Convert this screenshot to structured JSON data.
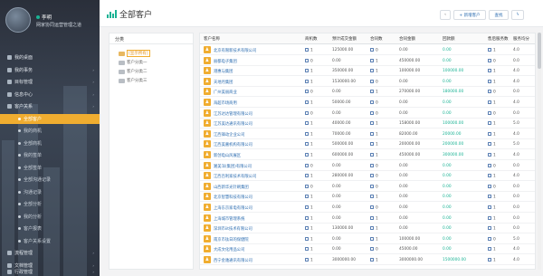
{
  "sidebar": {
    "user": {
      "name": "李明",
      "role": "网家协同运营管理之道"
    },
    "items": [
      {
        "label": "我的桌面",
        "icon": "monitor-icon"
      },
      {
        "label": "我的事务",
        "icon": "inbox-icon",
        "caret": true
      },
      {
        "label": "目标管理",
        "icon": "target-icon",
        "caret": true
      },
      {
        "label": "信息中心",
        "icon": "info-icon",
        "caret": true
      },
      {
        "label": "客户关系",
        "icon": "customer-icon",
        "caret": true
      },
      {
        "label": "全部客户",
        "sub": true,
        "active": true
      },
      {
        "label": "我的商机",
        "sub": true
      },
      {
        "label": "全部商机",
        "sub": true
      },
      {
        "label": "我的签单",
        "sub": true
      },
      {
        "label": "全部签单",
        "sub": true
      },
      {
        "label": "全部沟通记录",
        "sub": true
      },
      {
        "label": "沟通记录",
        "sub": true
      },
      {
        "label": "全部分析",
        "sub": true
      },
      {
        "label": "我的分析",
        "sub": true
      },
      {
        "label": "客户报表",
        "sub": true
      },
      {
        "label": "客户关系设置",
        "sub": true
      },
      {
        "label": "流程管理",
        "icon": "flow-icon",
        "caret": true
      },
      {
        "label": "文档管理",
        "icon": "doc-icon",
        "caret": true
      },
      {
        "label": "行政管理",
        "icon": "admin-icon",
        "caret": true
      }
    ]
  },
  "header": {
    "title": "全部客户",
    "buttons": {
      "back": "‹",
      "new": "+ 新增客户",
      "search": "查找",
      "help": "ϟ"
    }
  },
  "categories": {
    "title": "分类",
    "items": [
      {
        "label": "[显示所有]",
        "selected": true
      },
      {
        "label": "客户分类一"
      },
      {
        "label": "客户分类二"
      },
      {
        "label": "客户分类三"
      }
    ]
  },
  "table": {
    "columns": [
      "客户名称",
      "商机数",
      "预计成交金额",
      "合同数",
      "合同金额",
      "回款额",
      "售后服务数",
      "服务均分"
    ],
    "rows": [
      [
        "北京有限新技术有限公司",
        "1",
        "125000.00",
        "0",
        "0.00",
        "0.00",
        "1",
        "4.0"
      ],
      [
        "丽都电子集团",
        "0",
        "0.00",
        "1",
        "450000.00",
        "0.00",
        "0",
        "0.0"
      ],
      [
        "港惠与集团",
        "1",
        "350000.00",
        "1",
        "100000.00",
        "100000.00",
        "1",
        "4.0"
      ],
      [
        "天地月集团",
        "1",
        "1530000.00",
        "0",
        "0.00",
        "0.00",
        "1",
        "4.0"
      ],
      [
        "广州美丽商业",
        "0",
        "0.00",
        "1",
        "270000.00",
        "180000.00",
        "0",
        "0.0"
      ],
      [
        "海超市场商用",
        "1",
        "50000.00",
        "0",
        "0.00",
        "0.00",
        "1",
        "4.0"
      ],
      [
        "江苏达达管理有限公司",
        "0",
        "0.00",
        "0",
        "0.00",
        "0.00",
        "0",
        "0.0"
      ],
      [
        "江苏美达通讯有限公司",
        "1",
        "40000.00",
        "1",
        "158000.00",
        "100000.00",
        "1",
        "5.0"
      ],
      [
        "江西锋动企业公司",
        "1",
        "70000.00",
        "1",
        "82000.00",
        "20000.00",
        "1",
        "4.0"
      ],
      [
        "江西美嘉机构有限公司",
        "1",
        "500000.00",
        "1",
        "200000.00",
        "200000.00",
        "1",
        "5.0"
      ],
      [
        "新创电山风展区",
        "1",
        "600000.00",
        "1",
        "450000.00",
        "300000.00",
        "1",
        "4.0"
      ],
      [
        "湘美洋(集团)有限公司",
        "0",
        "0.00",
        "0",
        "0.00",
        "0.00",
        "0",
        "0.0"
      ],
      [
        "江西百利家技术有限公司",
        "1",
        "280000.00",
        "0",
        "0.00",
        "0.00",
        "1",
        "4.0"
      ],
      [
        "山西新华光针刷集团",
        "0",
        "0.00",
        "0",
        "0.00",
        "0.00",
        "0",
        "0.0"
      ],
      [
        "北京智慧科技有限公司",
        "1",
        "0.00",
        "1",
        "0.00",
        "0.00",
        "1",
        "0.0"
      ],
      [
        "上海东京家电有限公司",
        "1",
        "0.00",
        "0",
        "0.00",
        "0.00",
        "1",
        "0.0"
      ],
      [
        "上海城市管理系统",
        "1",
        "0.00",
        "1",
        "0.00",
        "0.00",
        "1",
        "0.0"
      ],
      [
        "深圳市iit技术有限公司",
        "1",
        "130000.00",
        "1",
        "0.00",
        "0.00",
        "1",
        "0.0"
      ],
      [
        "南京市钛日的保健院",
        "1",
        "0.00",
        "1",
        "100000.00",
        "0.00",
        "0",
        "5.0"
      ],
      [
        "大成文化用品公司",
        "1",
        "0.00",
        "0",
        "45000.00",
        "0.00",
        "1",
        "4.0"
      ],
      [
        "西宁金驰通讯有限公司",
        "1",
        "3000000.00",
        "1",
        "3000000.00",
        "1500000.00",
        "1",
        "4.0"
      ]
    ]
  }
}
